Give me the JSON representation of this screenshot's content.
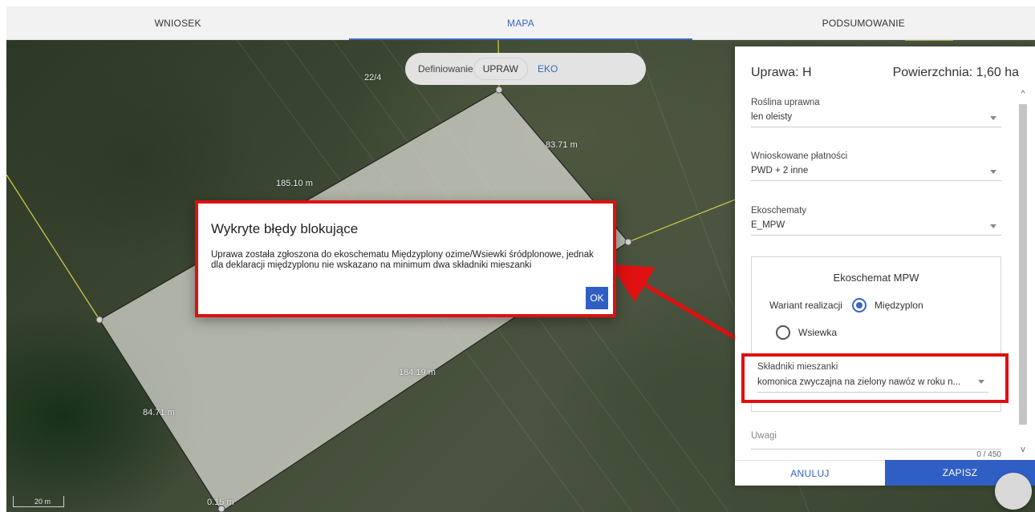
{
  "nav": {
    "tabs": [
      {
        "label": "WNIOSEK"
      },
      {
        "label": "MAPA"
      },
      {
        "label": "PODSUMOWANIE"
      }
    ]
  },
  "map": {
    "parcel_label": "22/4",
    "dims": {
      "top_right": "83.71 m",
      "top_left": "185.10 m",
      "bottom": "184.19 m",
      "left": "84.71 m",
      "bottom_corner": "0.15 m"
    },
    "scale_label": "20 m"
  },
  "definiowanie": {
    "label": "Definiowanie",
    "upraw": "UPRAW",
    "eko": "EKO"
  },
  "dialog": {
    "title": "Wykryte błędy blokujące",
    "message": "Uprawa została zgłoszona do ekoschematu Międzyplony ozime/Wsiewki śródplonowe, jednak dla deklaracji międzyplonu nie wskazano na minimum dwa składniki mieszanki",
    "ok_label": "OK"
  },
  "panel": {
    "title": "Uprawa: H",
    "area": "Powierzchnia: 1,60 ha",
    "roslina": {
      "label": "Roślina uprawna",
      "value": "len oleisty"
    },
    "platnosci": {
      "label": "Wnioskowane płatności",
      "value": "PWD + 2 inne"
    },
    "ekoschematy": {
      "label": "Ekoschematy",
      "value": "E_MPW"
    },
    "mpw": {
      "title": "Ekoschemat MPW",
      "wariant_label": "Wariant realizacji",
      "option1": "Międzyplon",
      "option2": "Wsiewka"
    },
    "skladniki": {
      "label": "Składniki mieszanki",
      "value": "komonica zwyczajna na zielony nawóz w roku n..."
    },
    "uwagi": {
      "label": "Uwagi",
      "counter": "0 / 450"
    },
    "cancel_label": "ANULUJ",
    "save_label": "ZAPISZ"
  },
  "colors": {
    "accent": "#2f5fc4",
    "highlight": "#e01010"
  }
}
